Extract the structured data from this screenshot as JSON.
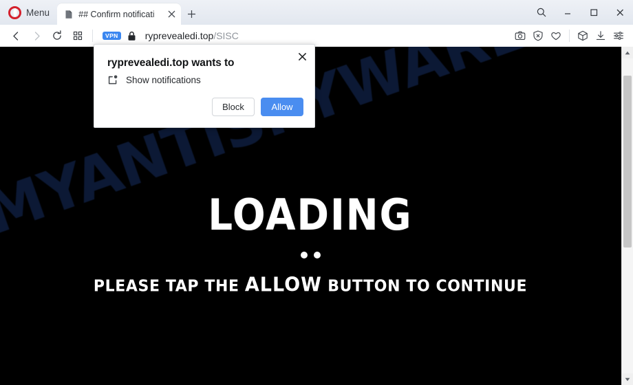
{
  "browser": {
    "name": "Opera",
    "menu_label": "Menu",
    "tabs": [
      {
        "title": "## Confirm notificati",
        "favicon": "document-icon",
        "close_icon": "close-icon"
      }
    ],
    "new_tab_label": "+",
    "window_controls": [
      {
        "name": "search-icon",
        "glyph": "search"
      },
      {
        "name": "minimize-icon",
        "glyph": "minimize"
      },
      {
        "name": "maximize-icon",
        "glyph": "maximize"
      },
      {
        "name": "close-icon",
        "glyph": "close"
      }
    ],
    "nav": {
      "back": "back-arrow-icon",
      "forward": "forward-arrow-icon",
      "reload": "reload-icon",
      "apps": "apps-grid-icon"
    },
    "address": {
      "vpn_badge": "VPN",
      "lock": "lock-icon",
      "domain": "ryprevealedi.top",
      "path": "/SISC",
      "full_url": "ryprevealedi.top/SISC"
    },
    "toolbar_icons": [
      {
        "name": "snapshot-camera-icon"
      },
      {
        "name": "ad-blocker-shield-icon"
      },
      {
        "name": "heart-favorites-icon"
      },
      {
        "name": "workspaces-cube-icon"
      },
      {
        "name": "downloads-icon"
      },
      {
        "name": "easy-setup-sliders-icon"
      }
    ]
  },
  "dialog": {
    "title": "ryprevealedi.top wants to",
    "permission_label": "Show notifications",
    "permission_icon": "notification-bell-icon",
    "close_icon": "close-icon",
    "block_label": "Block",
    "allow_label": "Allow",
    "allow_color": "#4a8df0"
  },
  "page": {
    "background_color": "#000000",
    "watermark": "MYANTISPYWARE.COM",
    "watermark_color": "#0e1c3a",
    "heading": "LOADING",
    "dots_count": 2,
    "subtext_before": "PLEASE TAP THE",
    "subtext_emphasis": "ALLOW",
    "subtext_after": "BUTTON TO CONTINUE",
    "text_color": "#ffffff"
  },
  "scrollbar": {
    "up_arrow": "scroll-up-arrow-icon",
    "down_arrow": "scroll-down-arrow-icon",
    "thumb": "scrollbar-thumb"
  }
}
